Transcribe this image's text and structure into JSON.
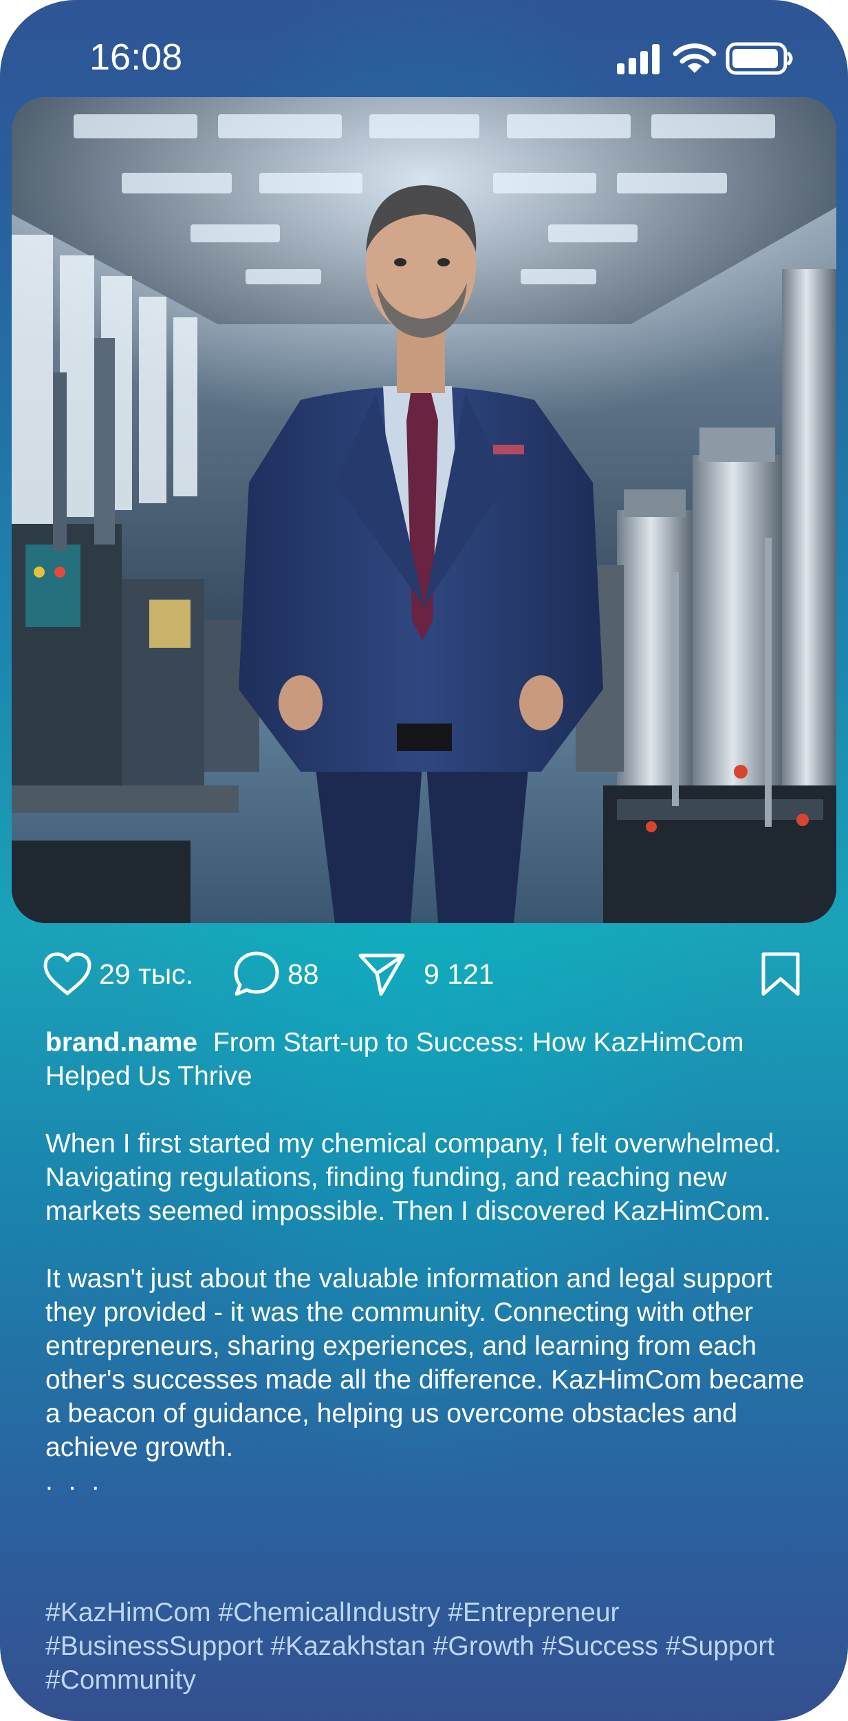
{
  "status_bar": {
    "time": "16:08"
  },
  "post": {
    "photo_alt": "",
    "actions": {
      "likes": "29 тыс.",
      "comments": "88",
      "shares": "9 121"
    },
    "caption": {
      "username": "brand.name",
      "headline": "From Start-up to Success: How KazHimCom Helped Us Thrive",
      "paragraph_1": "When I first started my chemical company, I felt overwhelmed. Navigating regulations, finding funding, and reaching new markets seemed impossible. Then I discovered KazHimCom.",
      "paragraph_2": "It wasn't just about the valuable information and legal support they provided - it was the community. Connecting with other entrepreneurs, sharing experiences, and learning from each other's successes made all the difference. KazHimCom became a beacon of guidance, helping us overcome obstacles and achieve growth.",
      "more": ". . .",
      "hashtags": "#KazHimCom #ChemicalIndustry #Entrepreneur #BusinessSupport #Kazakhstan #Growth #Success #Support #Community"
    }
  },
  "icons": {
    "signal": "signal-icon",
    "wifi": "wifi-icon",
    "battery": "battery-icon",
    "like": "heart-icon",
    "comment": "comment-bubble-icon",
    "share": "paper-plane-icon",
    "save": "bookmark-icon"
  },
  "colors": {
    "text": "#ffffff",
    "hashtag": "#bcd7f2",
    "gradient_top": "#2f5595",
    "gradient_mid": "#1aa3b9",
    "gradient_bottom": "#35508f"
  }
}
